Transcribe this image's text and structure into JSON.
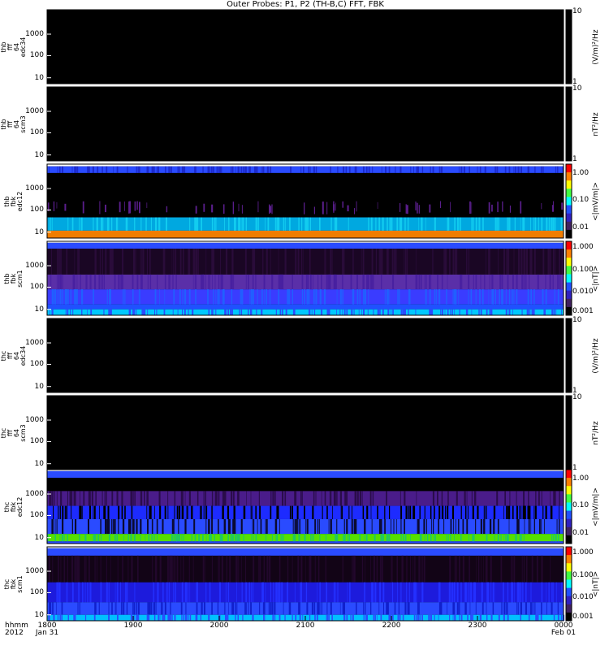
{
  "title": "Outer Probes: P1, P2 (TH-B,C) FFT, FBK",
  "x_axis": {
    "row1_label": "hhmm",
    "row2_label": "2012",
    "ticks": [
      "1800",
      "1900",
      "2000",
      "2100",
      "2200",
      "2300",
      "0000"
    ],
    "dates": [
      {
        "tick": 0,
        "text": "Jan 31"
      },
      {
        "tick": 6,
        "text": "Feb 01"
      }
    ]
  },
  "chart_data": [
    {
      "type": "heatmap",
      "panel_label": [
        "thb",
        "fff",
        "64",
        "edc34"
      ],
      "yticks": [
        "1000",
        "100",
        "10"
      ],
      "yscale": "log",
      "colorbar": {
        "label": "(V/m)²/Hz",
        "ticks": [
          "10",
          "1"
        ],
        "style": "empty"
      },
      "content": "empty"
    },
    {
      "type": "heatmap",
      "panel_label": [
        "thb",
        "fff",
        "64",
        "scm3"
      ],
      "yticks": [
        "1000",
        "100",
        "10"
      ],
      "yscale": "log",
      "colorbar": {
        "label": "nT²/Hz",
        "ticks": [
          "10",
          "1"
        ],
        "style": "empty"
      },
      "content": "empty"
    },
    {
      "type": "heatmap",
      "panel_label": [
        "thb",
        "fbk",
        "edc12"
      ],
      "yticks": [
        "1000",
        "100",
        "10"
      ],
      "yscale": "log",
      "colorbar": {
        "label": "<|mV/m|>",
        "ticks": [
          "1.00",
          "0.10",
          "0.01"
        ],
        "style": "rainbow"
      },
      "content": "bands",
      "bands": [
        {
          "from": 0.0,
          "to": 0.03,
          "color": "#ffffff"
        },
        {
          "from": 0.03,
          "to": 0.12,
          "color": "#2a4bff",
          "stripe": "#1d2bcc"
        },
        {
          "from": 0.12,
          "to": 0.5,
          "color": "#000000"
        },
        {
          "from": 0.5,
          "to": 0.68,
          "color": "#000000",
          "stripe": "#5a1e8c",
          "sparse": true
        },
        {
          "from": 0.68,
          "to": 0.72,
          "color": "#000000"
        },
        {
          "from": 0.72,
          "to": 0.9,
          "color": "#00a8e0",
          "stripe": "#12ccf0"
        },
        {
          "from": 0.9,
          "to": 1.0,
          "color": "#f07d00"
        }
      ]
    },
    {
      "type": "heatmap",
      "panel_label": [
        "thb",
        "fbk",
        "scm1"
      ],
      "yticks": [
        "1000",
        "100",
        "10"
      ],
      "yscale": "log",
      "colorbar": {
        "label": "<|nT|>",
        "ticks": [
          "1.000",
          "0.100",
          "0.010",
          "0.001"
        ],
        "style": "rainbow"
      },
      "content": "bands",
      "bands": [
        {
          "from": 0.0,
          "to": 0.02,
          "color": "#ffffff"
        },
        {
          "from": 0.02,
          "to": 0.1,
          "color": "#2a4bff"
        },
        {
          "from": 0.1,
          "to": 0.45,
          "color": "#1a0624",
          "stripe": "#2a0c3a"
        },
        {
          "from": 0.45,
          "to": 0.65,
          "color": "#5a2fa8",
          "stripe": "#4820a0"
        },
        {
          "from": 0.65,
          "to": 0.85,
          "color": "#3a3cff",
          "stripe": "#2060ff"
        },
        {
          "from": 0.85,
          "to": 0.92,
          "color": "#2050ff"
        },
        {
          "from": 0.92,
          "to": 1.0,
          "color": "#00c8ff",
          "stripe": "#2a4bff"
        }
      ]
    },
    {
      "type": "heatmap",
      "panel_label": [
        "thc",
        "fff",
        "64",
        "edc34"
      ],
      "yticks": [
        "1000",
        "100",
        "10"
      ],
      "yscale": "log",
      "colorbar": {
        "label": "(V/m)²/Hz",
        "ticks": [
          "10",
          "1"
        ],
        "style": "empty"
      },
      "content": "empty"
    },
    {
      "type": "heatmap",
      "panel_label": [
        "thc",
        "fff",
        "64",
        "scm3"
      ],
      "yticks": [
        "1000",
        "100",
        "10"
      ],
      "yscale": "log",
      "colorbar": {
        "label": "nT²/Hz",
        "ticks": [
          "10",
          "1"
        ],
        "style": "empty"
      },
      "content": "empty"
    },
    {
      "type": "heatmap",
      "panel_label": [
        "thc",
        "fbk",
        "edc12"
      ],
      "yticks": [
        "1000",
        "100",
        "10"
      ],
      "yscale": "log",
      "colorbar": {
        "label": "<|mV/m|>",
        "ticks": [
          "1.00",
          "0.10",
          "0.01"
        ],
        "style": "rainbow"
      },
      "content": "bands",
      "bands": [
        {
          "from": 0.0,
          "to": 0.02,
          "color": "#ffffff"
        },
        {
          "from": 0.02,
          "to": 0.11,
          "color": "#2a4bff"
        },
        {
          "from": 0.11,
          "to": 0.29,
          "color": "#000000"
        },
        {
          "from": 0.29,
          "to": 0.49,
          "color": "#4a1c8a",
          "stripe": "#2a0c4a"
        },
        {
          "from": 0.49,
          "to": 0.67,
          "color": "#1d2bff",
          "stripe": "#000000"
        },
        {
          "from": 0.67,
          "to": 0.87,
          "color": "#2a4bff",
          "stripe": "#0a0a30"
        },
        {
          "from": 0.87,
          "to": 0.97,
          "color": "#55e000",
          "stripe": "#20c860"
        },
        {
          "from": 0.97,
          "to": 1.0,
          "color": "#2a4bff"
        }
      ]
    },
    {
      "type": "heatmap",
      "panel_label": [
        "thc",
        "fbk",
        "scm1"
      ],
      "yticks": [
        "1000",
        "100",
        "10"
      ],
      "yscale": "log",
      "colorbar": {
        "label": "<|nT|>",
        "ticks": [
          "1.000",
          "0.100",
          "0.010",
          "0.001"
        ],
        "style": "rainbow"
      },
      "content": "bands",
      "bands": [
        {
          "from": 0.0,
          "to": 0.02,
          "color": "#ffffff"
        },
        {
          "from": 0.02,
          "to": 0.12,
          "color": "#2a4bff"
        },
        {
          "from": 0.12,
          "to": 0.48,
          "color": "#120416",
          "stripe": "#22082c"
        },
        {
          "from": 0.48,
          "to": 0.75,
          "color": "#1d1bdc",
          "stripe": "#2430ff"
        },
        {
          "from": 0.75,
          "to": 0.92,
          "color": "#2a4bff",
          "stripe": "#1020cc"
        },
        {
          "from": 0.92,
          "to": 1.0,
          "color": "#00c0ff",
          "stripe": "#2a4bff"
        }
      ]
    }
  ]
}
